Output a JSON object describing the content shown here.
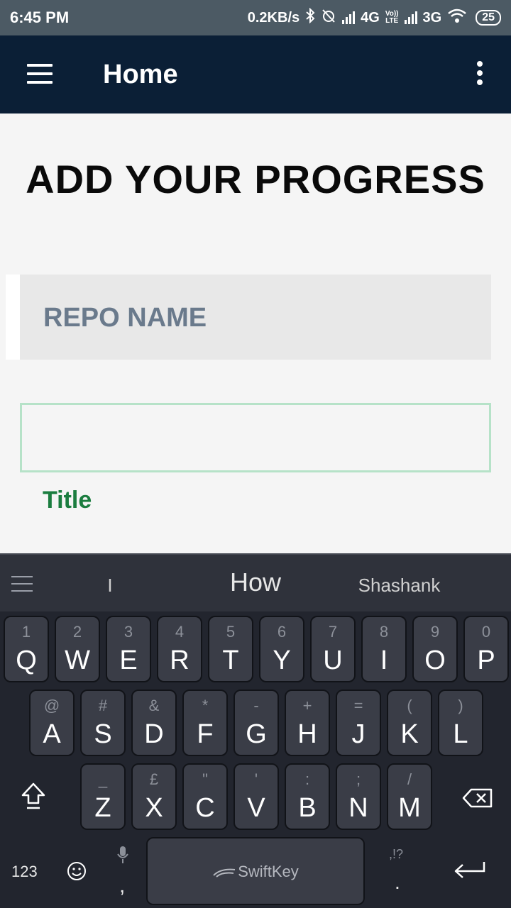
{
  "status_bar": {
    "time": "6:45 PM",
    "speed": "0.2KB/s",
    "net1": "4G",
    "volte": "Vo))",
    "lte": "LTE",
    "net2": "3G",
    "battery": "25"
  },
  "app_bar": {
    "title": "Home",
    "menu_icon": "hamburger-menu-icon",
    "overflow_icon": "more-vert-icon"
  },
  "content": {
    "heading": "ADD YOUR PROGRESS",
    "repo_name_label": "REPO NAME",
    "title_input_value": "",
    "title_label": "Title"
  },
  "keyboard": {
    "suggestions": [
      "I",
      "How",
      "Shashank"
    ],
    "row1": [
      {
        "hint": "1",
        "key": "Q"
      },
      {
        "hint": "2",
        "key": "W"
      },
      {
        "hint": "3",
        "key": "E"
      },
      {
        "hint": "4",
        "key": "R"
      },
      {
        "hint": "5",
        "key": "T"
      },
      {
        "hint": "6",
        "key": "Y"
      },
      {
        "hint": "7",
        "key": "U"
      },
      {
        "hint": "8",
        "key": "I"
      },
      {
        "hint": "9",
        "key": "O"
      },
      {
        "hint": "0",
        "key": "P"
      }
    ],
    "row2": [
      {
        "hint": "@",
        "key": "A"
      },
      {
        "hint": "#",
        "key": "S"
      },
      {
        "hint": "&",
        "key": "D"
      },
      {
        "hint": "*",
        "key": "F"
      },
      {
        "hint": "-",
        "key": "G"
      },
      {
        "hint": "+",
        "key": "H"
      },
      {
        "hint": "=",
        "key": "J"
      },
      {
        "hint": "(",
        "key": "K"
      },
      {
        "hint": ")",
        "key": "L"
      }
    ],
    "row3": [
      {
        "hint": "_",
        "key": "Z"
      },
      {
        "hint": "£",
        "key": "X"
      },
      {
        "hint": "\"",
        "key": "C"
      },
      {
        "hint": "'",
        "key": "V"
      },
      {
        "hint": ":",
        "key": "B"
      },
      {
        "hint": ";",
        "key": "N"
      },
      {
        "hint": "/",
        "key": "M"
      }
    ],
    "numbers_label": "123",
    "comma": ",",
    "space_label": "SwiftKey",
    "punct_hint": ",!?",
    "period": "."
  }
}
